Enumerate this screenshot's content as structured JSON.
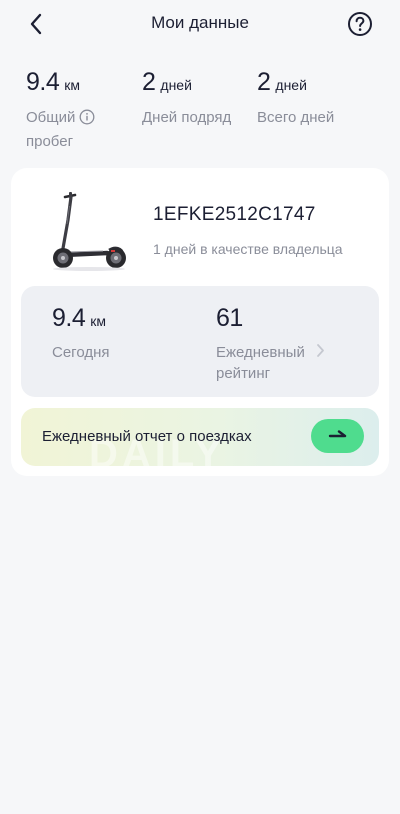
{
  "header": {
    "title": "Мои данные",
    "back_icon": "chevron-left-icon",
    "help_icon": "question-circle-icon"
  },
  "stats": [
    {
      "value": "9.4",
      "unit": "км",
      "label_line1": "Общий",
      "label_line2": "пробег",
      "has_info": true
    },
    {
      "value": "2",
      "unit": "дней",
      "label_line1": "Дней подряд",
      "label_line2": "",
      "has_info": false
    },
    {
      "value": "2",
      "unit": "дней",
      "label_line1": "Всего дней",
      "label_line2": "",
      "has_info": false
    }
  ],
  "vehicle": {
    "serial": "1EFKE2512C1747",
    "owner_text": "1 дней в качестве владельца"
  },
  "today": {
    "value": "9.4",
    "unit": "км",
    "label": "Сегодня"
  },
  "rating": {
    "value": "61",
    "label_line1": "Ежедневный",
    "label_line2": "рейтинг"
  },
  "report": {
    "label": "Ежедневный отчет о поездках",
    "watermark": "DAILY",
    "button_icon": "arrow-right-icon"
  },
  "colors": {
    "accent": "#4fdc8e",
    "text_primary": "#1c1f33",
    "text_secondary": "#8a8d99",
    "background": "#f6f7f9"
  }
}
